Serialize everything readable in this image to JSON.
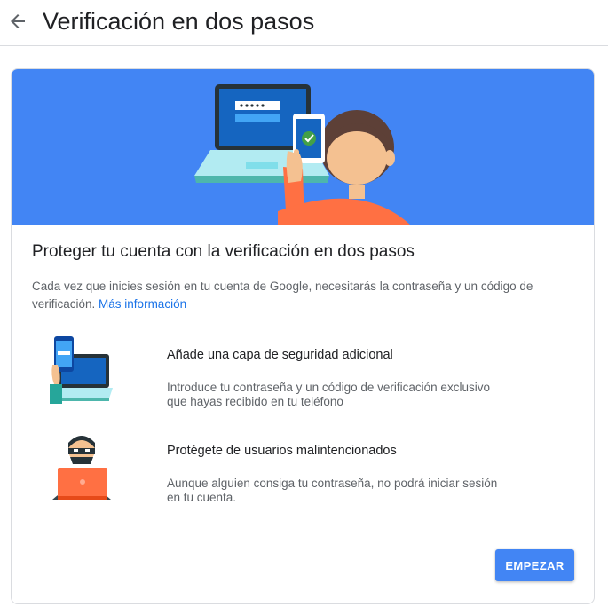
{
  "header": {
    "back_icon": "arrow-back-icon",
    "title": "Verificación en dos pasos"
  },
  "card": {
    "hero_icon": "laptop-phone-verification-illustration",
    "hero_color": "#4285f4",
    "title": "Proteger tu cuenta con la verificación en dos pasos",
    "description": "Cada vez que inicies sesión en tu cuenta de Google, necesitarás la contraseña y un código de verificación.",
    "learn_more_link": "Más información",
    "features": [
      {
        "icon": "phone-laptop-security-icon",
        "title": "Añade una capa de seguridad adicional",
        "description": "Introduce tu contraseña y un código de verificación exclusivo que hayas recibido en tu teléfono"
      },
      {
        "icon": "hacker-icon",
        "title": "Protégete de usuarios malintencionados",
        "description": "Aunque alguien consiga tu contraseña, no podrá iniciar sesión en tu cuenta."
      }
    ],
    "start_button": "EMPEZAR"
  },
  "colors": {
    "accent": "#4285f4",
    "link": "#1a73e8",
    "text_primary": "#202124",
    "text_secondary": "#5f6368"
  }
}
